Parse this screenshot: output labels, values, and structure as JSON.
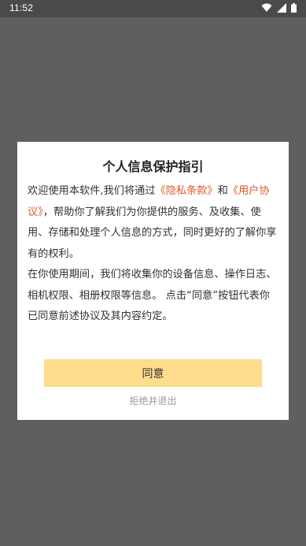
{
  "status_bar": {
    "time": "11:52",
    "icons": [
      "wifi-icon",
      "signal-icon",
      "battery-icon"
    ]
  },
  "dialog": {
    "title": "个人信息保护指引",
    "intro_prefix": "欢迎使用本软件,我们将通过",
    "privacy_link": "《隐私条款》",
    "and_text": "和",
    "user_agreement_link": "《用户协议》",
    "intro_suffix": "，帮助你了解我们为你提供的服务、及收集、使用、存储和处理个人信息的方式，同时更好的了解你享有的权利。",
    "paragraph_2": "在你使用期间，我们将收集你的设备信息、操作日志、相机权限、相册权限等信息。 点击“同意”按钮代表你已同意前述协议及其内容约定。",
    "agree_label": "同意",
    "refuse_label": "拒绝并退出"
  },
  "colors": {
    "overlay": "#5f5f5f",
    "link": "#e0582c",
    "agree_button": "#fddc8b"
  }
}
